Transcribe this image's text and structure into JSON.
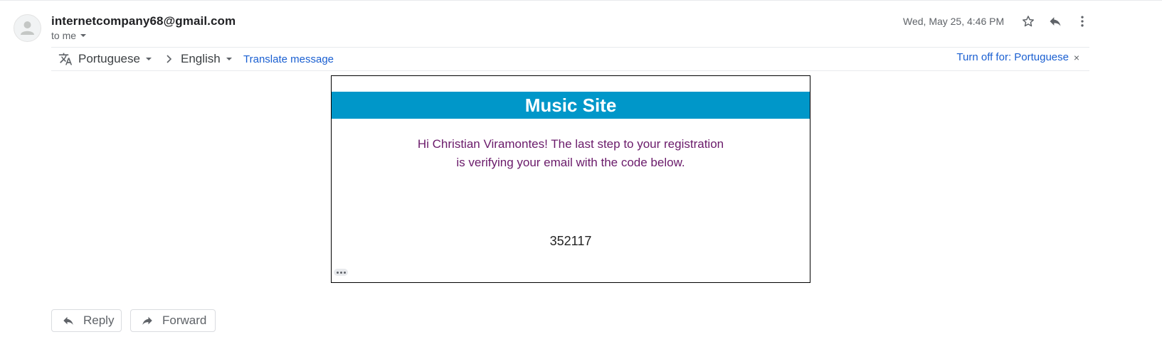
{
  "header": {
    "sender_email": "internetcompany68@gmail.com",
    "recipient_label": "to me",
    "date": "Wed, May 25, 4:46 PM",
    "icons": {
      "avatar": "person-icon",
      "star": "star-icon",
      "reply": "reply-icon",
      "more": "more-vert-icon"
    }
  },
  "translate_bar": {
    "source_language": "Portuguese",
    "target_language": "English",
    "translate_link": "Translate message",
    "turn_off_label": "Turn off for: Portuguese",
    "close_symbol": "×",
    "icon": "translate-icon"
  },
  "email_body": {
    "banner_title": "Music Site",
    "message_line1": "Hi Christian Viramontes! The last step to your registration",
    "message_line2": "is verifying your email with the code below.",
    "verification_code": "352117",
    "colors": {
      "banner": "#0097c9",
      "message_text": "#6a1a6a"
    }
  },
  "actions": {
    "reply_label": "Reply",
    "forward_label": "Forward"
  },
  "colors": {
    "link": "#1a5fd1",
    "muted_text": "#5f6368"
  }
}
